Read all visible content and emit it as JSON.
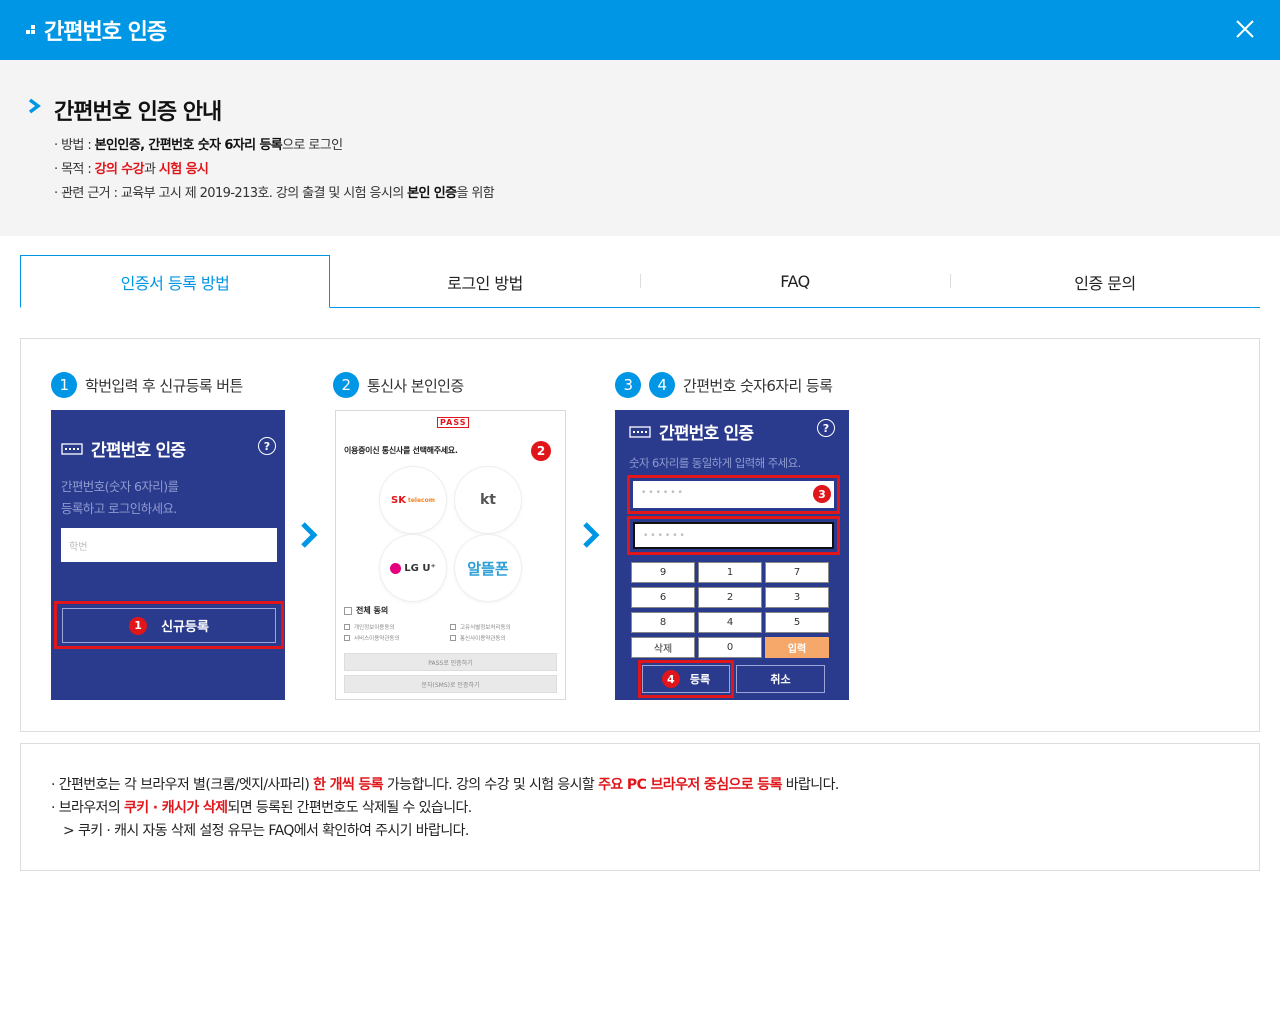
{
  "header": {
    "title": "간편번호 인증"
  },
  "intro": {
    "title": "간편번호 인증 안내",
    "method": {
      "prefix": "· 방법 : ",
      "bold": "본인인증, 간편번호 숫자 6자리 등록",
      "suffix": "으로 로그인"
    },
    "purpose": {
      "prefix": "· 목적 : ",
      "red1": "강의 수강",
      "mid": "과 ",
      "red2": "시험 응시"
    },
    "basis": {
      "prefix": "· 관련 근거 : 교육부 고시 제 2019-213호. 강의 출결 및 시험 응시의 ",
      "bold": "본인 인증",
      "suffix": "을 위함"
    }
  },
  "tabs": [
    "인증서 등록 방법",
    "로그인 방법",
    "FAQ",
    "인증 문의"
  ],
  "steps": {
    "s1": {
      "num": "1",
      "label": "학번입력 후 신규등록 버튼"
    },
    "s2": {
      "num": "2",
      "label": "통신사 본인인증"
    },
    "s3": {
      "num1": "3",
      "num2": "4",
      "label": "간편번호 숫자6자리 등록"
    }
  },
  "panel1": {
    "title": "간편번호 인증",
    "help": "?",
    "desc1": "간편번호(숫자 6자리)를",
    "desc2": "등록하고 로그인하세요.",
    "id_placeholder": "학번",
    "badge": "1",
    "new_button": "신규등록"
  },
  "panel2": {
    "brand": "PASS",
    "lead": "이용중이신 통신사를 선택해주세요.",
    "badge": "2",
    "carriers": {
      "sk": "SK",
      "sk_sub": "telecom",
      "kt": "kt",
      "lgu": "LG U⁺",
      "mvno": "알뜰폰"
    },
    "agree_all": "전체 동의",
    "terms": [
      "개인정보이용동의",
      "고유식별정보처리동의",
      "서비스이용약관동의",
      "통신사이용약관동의"
    ],
    "btn_pass": "PASS로 인증하기",
    "btn_sms": "문자(SMS)로 인증하기"
  },
  "panel3": {
    "title": "간편번호 인증",
    "help": "?",
    "desc": "숫자 6자리를 동일하게 입력해 주세요.",
    "pin_mask": "••••••",
    "badge3": "3",
    "badge4": "4",
    "keys": [
      "9",
      "1",
      "7",
      "6",
      "2",
      "3",
      "8",
      "4",
      "5",
      "삭제",
      "0",
      "입력"
    ],
    "register": "등록",
    "cancel": "취소"
  },
  "notes": {
    "line1": {
      "a": "· 간편번호는 각 브라우저 별(크롬/엣지/사파리) ",
      "r1": "한 개씩 등록",
      "b": " 가능합니다. 강의 수강 및 시험 응시할 ",
      "r2": "주요 PC 브라우저 중심으로 등록",
      "c": " 바랍니다."
    },
    "line2": {
      "a": "· 브라우저의 ",
      "r1": "쿠키 · 캐시가 삭제",
      "b": "되면 등록된 간편번호도 삭제될 수 있습니다."
    },
    "line3": "> 쿠키 · 캐시 자동 삭제 설정 유무는 FAQ에서 확인하여 주시기 바랍니다."
  },
  "colors": {
    "brand_blue": "#0096e6",
    "panel_navy": "#2a3a8c",
    "highlight_red": "#e0161b",
    "key_orange": "#f6a86b"
  }
}
